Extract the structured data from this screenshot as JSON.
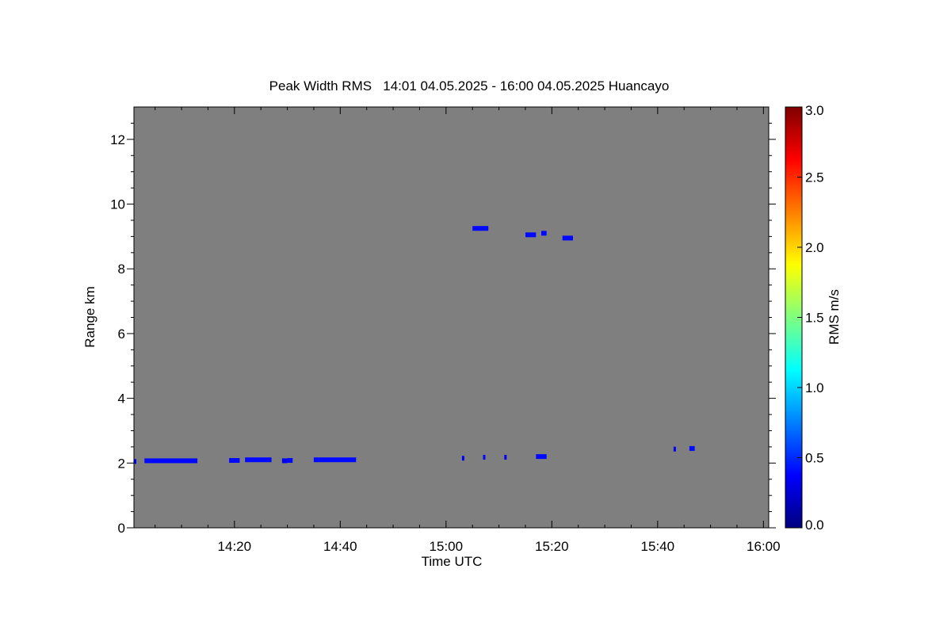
{
  "chart_data": {
    "type": "heatmap",
    "title": "Peak Width RMS   14:01 04.05.2025 - 16:00 04.05.2025 Huancayo",
    "xlabel": "Time UTC",
    "ylabel": "Range km",
    "xlim": [
      "14:01",
      "16:01"
    ],
    "ylim": [
      0,
      13
    ],
    "background_color": "#7f7f7f",
    "x_ticks": [
      "14:20",
      "14:40",
      "15:00",
      "15:20",
      "15:40",
      "16:00"
    ],
    "y_ticks": [
      "0",
      "2",
      "4",
      "6",
      "8",
      "10",
      "12"
    ],
    "colorbar": {
      "label": "RMS m/s",
      "range": [
        0.0,
        3.0
      ],
      "ticks": [
        "0.0",
        "0.5",
        "1.0",
        "1.5",
        "2.0",
        "2.5",
        "3.0"
      ],
      "colormap": "jet"
    },
    "segments": [
      {
        "t_start": "14:01",
        "t_end": "14:01",
        "range_km": 2.05,
        "rms": 0.35
      },
      {
        "t_start": "14:03",
        "t_end": "14:13",
        "range_km": 2.07,
        "rms": 0.4
      },
      {
        "t_start": "14:19",
        "t_end": "14:21",
        "range_km": 2.08,
        "rms": 0.4
      },
      {
        "t_start": "14:22",
        "t_end": "14:27",
        "range_km": 2.1,
        "rms": 0.4
      },
      {
        "t_start": "14:29",
        "t_end": "14:30",
        "range_km": 2.07,
        "rms": 0.35
      },
      {
        "t_start": "14:30",
        "t_end": "14:31",
        "range_km": 2.08,
        "rms": 0.4
      },
      {
        "t_start": "14:35",
        "t_end": "14:36",
        "range_km": 2.1,
        "rms": 0.4
      },
      {
        "t_start": "14:36",
        "t_end": "14:43",
        "range_km": 2.1,
        "rms": 0.4
      },
      {
        "t_start": "15:03",
        "t_end": "15:03",
        "range_km": 2.15,
        "rms": 0.35
      },
      {
        "t_start": "15:07",
        "t_end": "15:07",
        "range_km": 2.18,
        "rms": 0.4
      },
      {
        "t_start": "15:11",
        "t_end": "15:11",
        "range_km": 2.18,
        "rms": 0.35
      },
      {
        "t_start": "15:17",
        "t_end": "15:19",
        "range_km": 2.2,
        "rms": 0.4
      },
      {
        "t_start": "15:05",
        "t_end": "15:08",
        "range_km": 9.25,
        "rms": 0.4
      },
      {
        "t_start": "15:15",
        "t_end": "15:17",
        "range_km": 9.05,
        "rms": 0.4
      },
      {
        "t_start": "15:18",
        "t_end": "15:19",
        "range_km": 9.1,
        "rms": 0.4
      },
      {
        "t_start": "15:22",
        "t_end": "15:24",
        "range_km": 8.95,
        "rms": 0.4
      },
      {
        "t_start": "15:43",
        "t_end": "15:43",
        "range_km": 2.43,
        "rms": 0.35
      },
      {
        "t_start": "15:46",
        "t_end": "15:47",
        "range_km": 2.45,
        "rms": 0.4
      }
    ]
  }
}
